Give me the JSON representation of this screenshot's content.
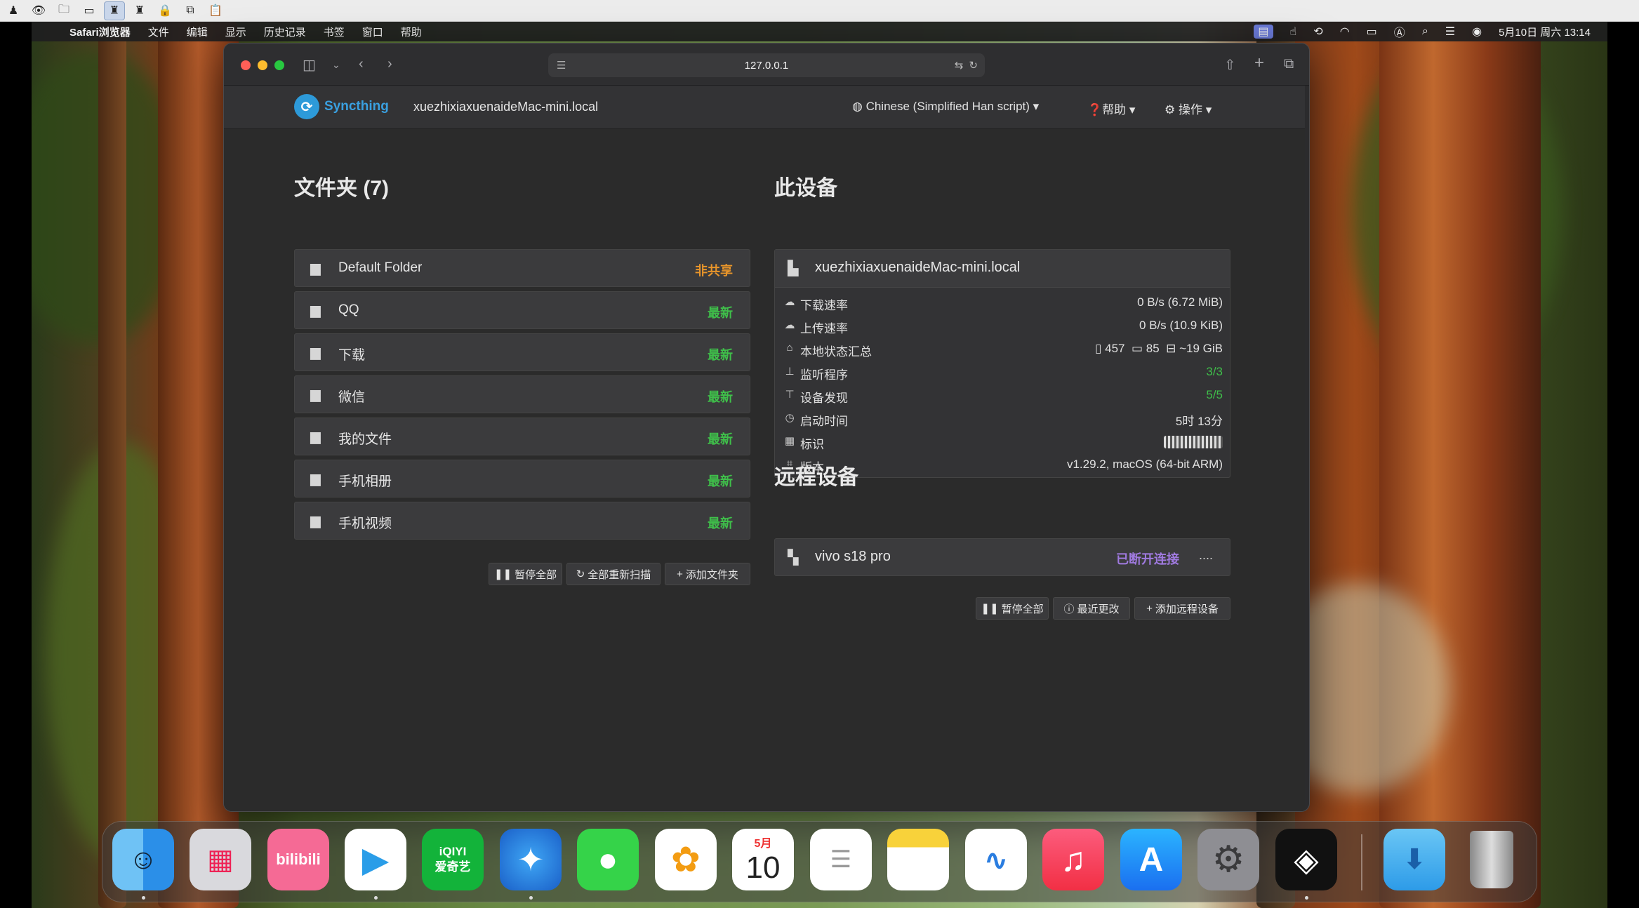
{
  "host_toolbar": {
    "icons": [
      "user-icon",
      "eye-icon",
      "folder-open-icon",
      "window-icon",
      "clipboard-user-icon",
      "clipboard-user-alt-icon",
      "lock-icon",
      "copy-icon",
      "paste-icon"
    ]
  },
  "menubar": {
    "app_name": "Safari浏览器",
    "items": [
      "文件",
      "编辑",
      "显示",
      "历史记录",
      "书签",
      "窗口",
      "帮助"
    ],
    "datetime": "5月10日 周六 13:14"
  },
  "safari": {
    "url": "127.0.0.1"
  },
  "syncthing": {
    "brand": "Syncthing",
    "device_name": "xuezhixiaxuenaideMac-mini.local",
    "nav": {
      "language": "Chinese (Simplified Han script)",
      "help": "帮助",
      "actions": "操作"
    },
    "folders_title": "文件夹 (7)",
    "folders": [
      {
        "name": "Default Folder",
        "status": "非共享",
        "color": "#e8952a"
      },
      {
        "name": "QQ",
        "status": "最新",
        "color": "#3fbf4a"
      },
      {
        "name": "下载",
        "status": "最新",
        "color": "#3fbf4a"
      },
      {
        "name": "微信",
        "status": "最新",
        "color": "#3fbf4a"
      },
      {
        "name": "我的文件",
        "status": "最新",
        "color": "#3fbf4a"
      },
      {
        "name": "手机相册",
        "status": "最新",
        "color": "#3fbf4a"
      },
      {
        "name": "手机视频",
        "status": "最新",
        "color": "#3fbf4a"
      }
    ],
    "folder_buttons": {
      "pause_all": "暂停全部",
      "rescan_all": "全部重新扫描",
      "add_folder": "添加文件夹"
    },
    "this_device_title": "此设备",
    "this_device": {
      "name": "xuezhixiaxuenaideMac-mini.local",
      "rows": [
        {
          "label": "下载速率",
          "value": "0 B/s (6.72 MiB)"
        },
        {
          "label": "上传速率",
          "value": "0 B/s (10.9 KiB)"
        },
        {
          "label": "本地状态汇总",
          "files": "457",
          "dirs": "85",
          "size": "~19 GiB"
        },
        {
          "label": "监听程序",
          "value": "3/3"
        },
        {
          "label": "设备发现",
          "value": "5/5"
        },
        {
          "label": "启动时间",
          "value": "5时 13分"
        },
        {
          "label": "标识",
          "value": ""
        },
        {
          "label": "版本",
          "value": "v1.29.2, macOS (64-bit ARM)"
        }
      ]
    },
    "remote_title": "远程设备",
    "remote": {
      "name": "vivo s18 pro",
      "status": "已断开连接",
      "extra": "....",
      "status_color": "#a07ae0"
    },
    "device_buttons": {
      "pause_all": "暂停全部",
      "recent_changes": "最近更改",
      "add_remote": "添加远程设备"
    }
  },
  "dock": {
    "apps": [
      {
        "name": "Finder",
        "label": ""
      },
      {
        "name": "Launchpad",
        "label": ""
      },
      {
        "name": "bilibili",
        "label": "bilibili"
      },
      {
        "name": "Infuse",
        "label": ""
      },
      {
        "name": "iQIYI",
        "label": "iQIYI\n爱奇艺"
      },
      {
        "name": "Safari",
        "label": ""
      },
      {
        "name": "Messages",
        "label": ""
      },
      {
        "name": "Photos",
        "label": ""
      },
      {
        "name": "Calendar",
        "month": "5月",
        "day": "10"
      },
      {
        "name": "Reminders",
        "label": ""
      },
      {
        "name": "Notes",
        "label": ""
      },
      {
        "name": "Freeform",
        "label": ""
      },
      {
        "name": "Music",
        "label": ""
      },
      {
        "name": "App Store",
        "label": ""
      },
      {
        "name": "System Settings",
        "label": ""
      },
      {
        "name": "Syncthing Dock",
        "label": ""
      },
      {
        "name": "Downloads",
        "label": ""
      },
      {
        "name": "Trash",
        "label": ""
      }
    ]
  }
}
